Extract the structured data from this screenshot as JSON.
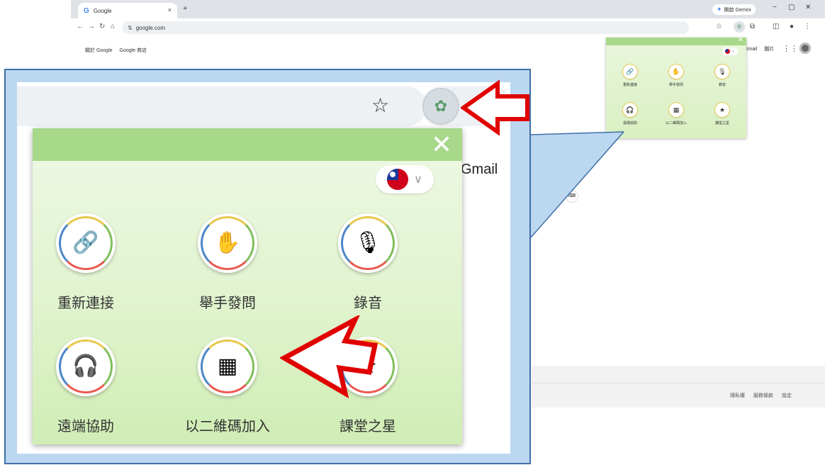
{
  "browser": {
    "tab_title": "Google",
    "tab_close": "×",
    "new_tab": "+",
    "gemini_label": "開啟 Gemini",
    "url": "google.com",
    "win_min": "−",
    "win_restore": "▢",
    "win_close": "✕"
  },
  "google_page": {
    "nav_left": [
      "關於 Google",
      "Google 商店"
    ],
    "gmail": "Gmail",
    "images": "圖片",
    "footer_links": [
      "隱私權",
      "服務條款",
      "設定"
    ]
  },
  "popup": {
    "close": "✕",
    "language_chevron": "∨",
    "items": [
      {
        "label": "重新連接",
        "icon": "reconnect-icon",
        "glyph": "🔗"
      },
      {
        "label": "舉手發問",
        "icon": "raise-hand-icon",
        "glyph": "✋"
      },
      {
        "label": "錄音",
        "icon": "microphone-icon",
        "glyph": "🎙"
      },
      {
        "label": "遠端協助",
        "icon": "headset-icon",
        "glyph": "🎧"
      },
      {
        "label": "以二維碼加入",
        "icon": "qr-scan-icon",
        "glyph": "▦"
      },
      {
        "label": "課堂之星",
        "icon": "class-star-icon",
        "glyph": "★"
      }
    ]
  },
  "zoom": {
    "gmail": "Gmail",
    "star": "☆"
  },
  "colors": {
    "popup_header": "#a8d88a",
    "popup_bg": "#dff3cc",
    "callout_frame": "#bcd7f0",
    "callout_border": "#3e6fa8",
    "arrow_fill": "#ffffff",
    "arrow_stroke": "#e00000"
  }
}
